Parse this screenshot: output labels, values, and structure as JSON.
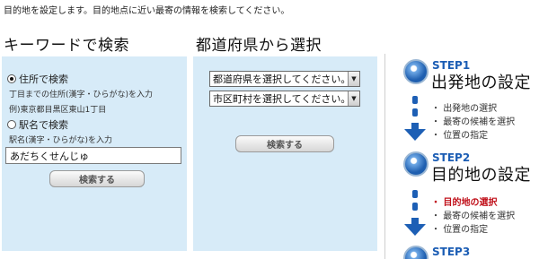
{
  "intro_text": "目的地を設定します。目的地点に近い最寄の情報を検索してください。",
  "keyword_section": {
    "heading": "キーワードで検索",
    "address_radio_label": "住所で検索",
    "address_hint_1": "丁目までの住所(漢字・ひらがな)を入力",
    "address_hint_2": "例)東京都目黒区東山1丁目",
    "station_radio_label": "駅名で検索",
    "station_hint": "駅名(漢字・ひらがな)を入力",
    "input_value": "あだちくせんじゅ",
    "search_button": "検索する"
  },
  "region_section": {
    "heading": "都道府県から選択",
    "prefecture_select": "都道府県を選択してください。",
    "city_select": "市区町村を選択してください。",
    "search_button": "検索する"
  },
  "steps": [
    {
      "label": "STEP1",
      "title": "出発地の設定",
      "items": [
        "出発地の選択",
        "最寄の候補を選択",
        "位置の指定"
      ]
    },
    {
      "label": "STEP2",
      "title": "目的地の設定",
      "items": [
        "目的地の選択",
        "最寄の候補を選択",
        "位置の指定"
      ]
    },
    {
      "label": "STEP3"
    }
  ],
  "colors": {
    "panel_bg": "#d7ebf8",
    "step_blue": "#1b5db4",
    "active_red": "#c0101a"
  }
}
